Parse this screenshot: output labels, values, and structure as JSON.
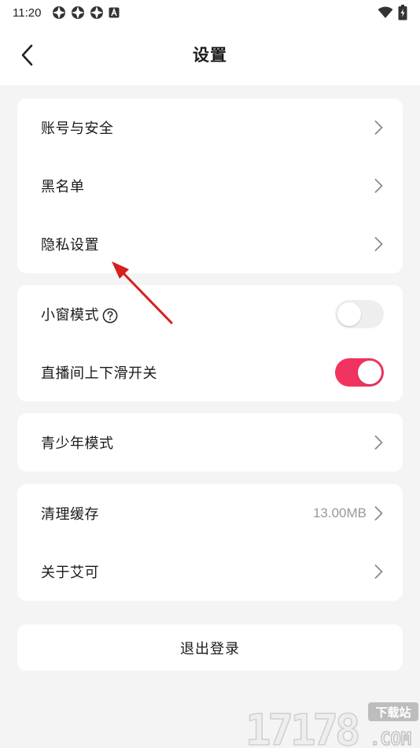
{
  "status": {
    "time": "11:20"
  },
  "header": {
    "title": "设置"
  },
  "groups": {
    "account": [
      "账号与安全",
      "黑名单",
      "隐私设置"
    ],
    "toggles": [
      {
        "label": "小窗模式",
        "on": false
      },
      {
        "label": "直播间上下滑开关",
        "on": true
      }
    ],
    "youth": "青少年模式",
    "misc": {
      "cache_label": "清理缓存",
      "cache_value": "13.00MB",
      "about_label": "关于艾可"
    }
  },
  "logout_label": "退出登录",
  "watermark": {
    "number": "17178",
    "tag": "下载站",
    "domain": ".COM"
  },
  "colors": {
    "accent": "#f0345f",
    "background": "#f4f4f4",
    "annotation": "#d61f1f"
  },
  "icons": [
    "chevron-left-icon",
    "chevron-right-icon",
    "help-circle-icon",
    "wifi-icon",
    "battery-icon"
  ]
}
